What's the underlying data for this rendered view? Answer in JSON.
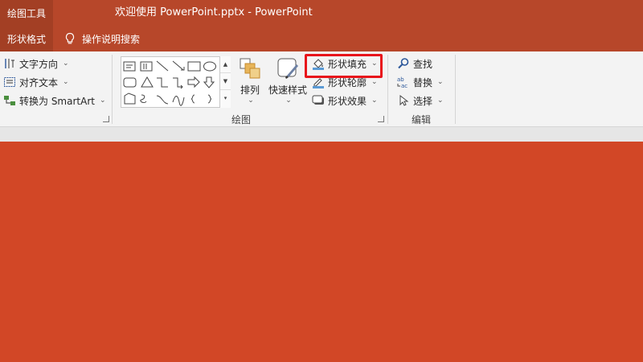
{
  "titlebar": {
    "context_tools": "绘图工具",
    "title": "欢迎使用 PowerPoint.pptx  -  PowerPoint"
  },
  "tabs": {
    "active": "形状格式",
    "tell_me": "操作说明搜索"
  },
  "text_group": {
    "text_direction": "文字方向",
    "align_text": "对齐文本",
    "convert_smartart": "转换为 SmartArt"
  },
  "drawing_group": {
    "label": "绘图",
    "arrange": "排列",
    "quick_styles": "快速样式",
    "shape_fill": "形状填充",
    "shape_outline": "形状轮廓",
    "shape_effects": "形状效果"
  },
  "editing_group": {
    "label": "编辑",
    "find": "查找",
    "replace": "替换",
    "select": "选择"
  },
  "colors": {
    "accent": "#b7472a",
    "accent_dark": "#a33f24",
    "slide": "#d24726",
    "highlight": "#e8141b"
  }
}
